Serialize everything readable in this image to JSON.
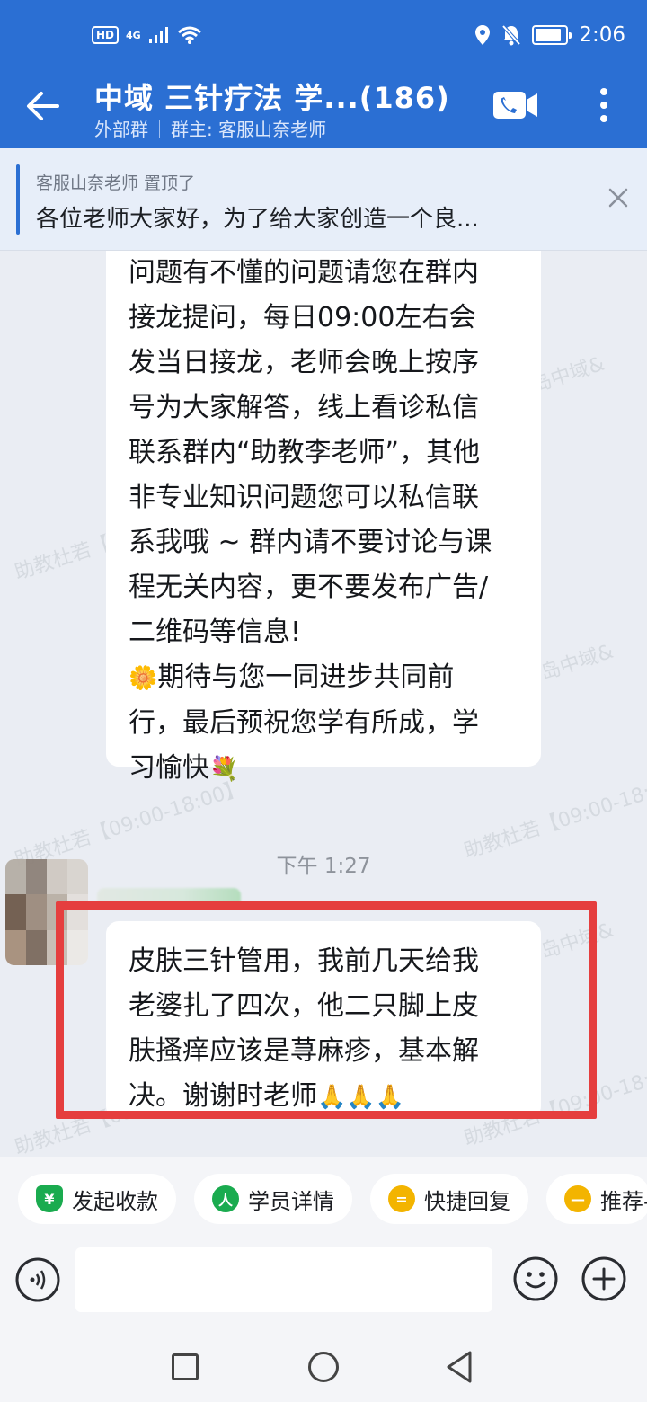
{
  "status_bar": {
    "hd_label": "HD",
    "network_label": "4G",
    "time": "2:06"
  },
  "header": {
    "title": "中域 三针疗法 学...(186)",
    "group_type": "外部群",
    "owner": "群主: 客服山奈老师"
  },
  "pinned": {
    "author": "客服山奈老师 置顶了",
    "text": "各位老师大家好，为了给大家创造一个良..."
  },
  "messages": {
    "first_lines": [
      "问题有不懂的问题请您在群内",
      "接龙提问，每日09:00左右会",
      "发当日接龙，老师会晚上按序",
      "号为大家解答，线上看诊私信",
      "联系群内“助教李老师”，其他",
      "非专业知识问题您可以私信联",
      "系我哦 ~ 群内请不要讨论与课",
      "程无关内容，更不要发布广告/",
      "二维码等信息!"
    ],
    "flower_emoji": "🌼",
    "wish_line_1": "期待与您一同进步共同前",
    "wish_line_2": "行，最后预祝您学有所成，学",
    "wish_line_3": "习愉快",
    "bouquet_emoji": "💐",
    "timestamp": "下午 1:27",
    "second_lines": [
      "皮肤三针管用，我前几天给我",
      "老婆扎了四次，他二只脚上皮",
      "肤搔痒应该是荨麻疹，基本解",
      "决。谢谢时老师"
    ],
    "thanks_emoji": "🙏🙏🙏"
  },
  "watermarks": {
    "text_a": "助教杜若【09:00-18:00】",
    "text_b": "岛中域&"
  },
  "quick_actions": [
    {
      "label": "发起收款",
      "icon": "¥",
      "color": "#1aab4f"
    },
    {
      "label": "学员详情",
      "icon": "人",
      "color": "#1aab4f"
    },
    {
      "label": "快捷回复",
      "icon": "=",
      "color": "#f3b400"
    },
    {
      "label": "推荐-",
      "icon": "—",
      "color": "#f3b400"
    }
  ],
  "composer": {
    "placeholder": ""
  },
  "colors": {
    "accent": "#2b6fd3",
    "highlight": "#e53e3e"
  }
}
